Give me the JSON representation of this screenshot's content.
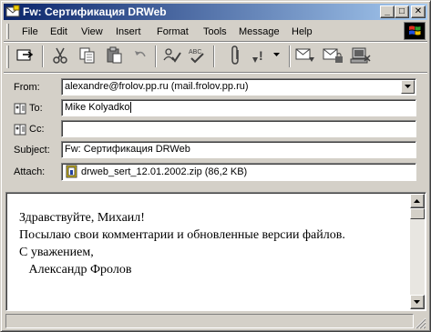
{
  "window": {
    "title": "Fw: Сертификация DRWeb",
    "controls": {
      "minimize": "_",
      "maximize": "□",
      "close": "✕"
    }
  },
  "menu": {
    "items": [
      "File",
      "Edit",
      "View",
      "Insert",
      "Format",
      "Tools",
      "Message",
      "Help"
    ]
  },
  "toolbar": {
    "icons": [
      "send-icon",
      "cut-icon",
      "copy-icon",
      "paste-icon",
      "undo-icon",
      "check-names-icon",
      "spelling-icon",
      "attach-icon",
      "priority-icon",
      "sign-icon",
      "encrypt-icon",
      "offline-icon"
    ]
  },
  "header": {
    "from_label": "From:",
    "from_value": "alexandre@frolov.pp.ru     (mail.frolov.pp.ru)",
    "to_label": "To:",
    "to_value": "Mike Kolyadko",
    "cc_label": "Cc:",
    "cc_value": "",
    "subject_label": "Subject:",
    "subject_value": "Fw: Сертификация DRWeb",
    "attach_label": "Attach:",
    "attach_value": "drweb_sert_12.01.2002.zip (86,2 KB)"
  },
  "body": {
    "lines": [
      "Здравствуйте, Михаил!",
      "Посылаю свои комментарии и обновленные версии файлов.",
      "С уважением,",
      "   Александр Фролов"
    ]
  }
}
